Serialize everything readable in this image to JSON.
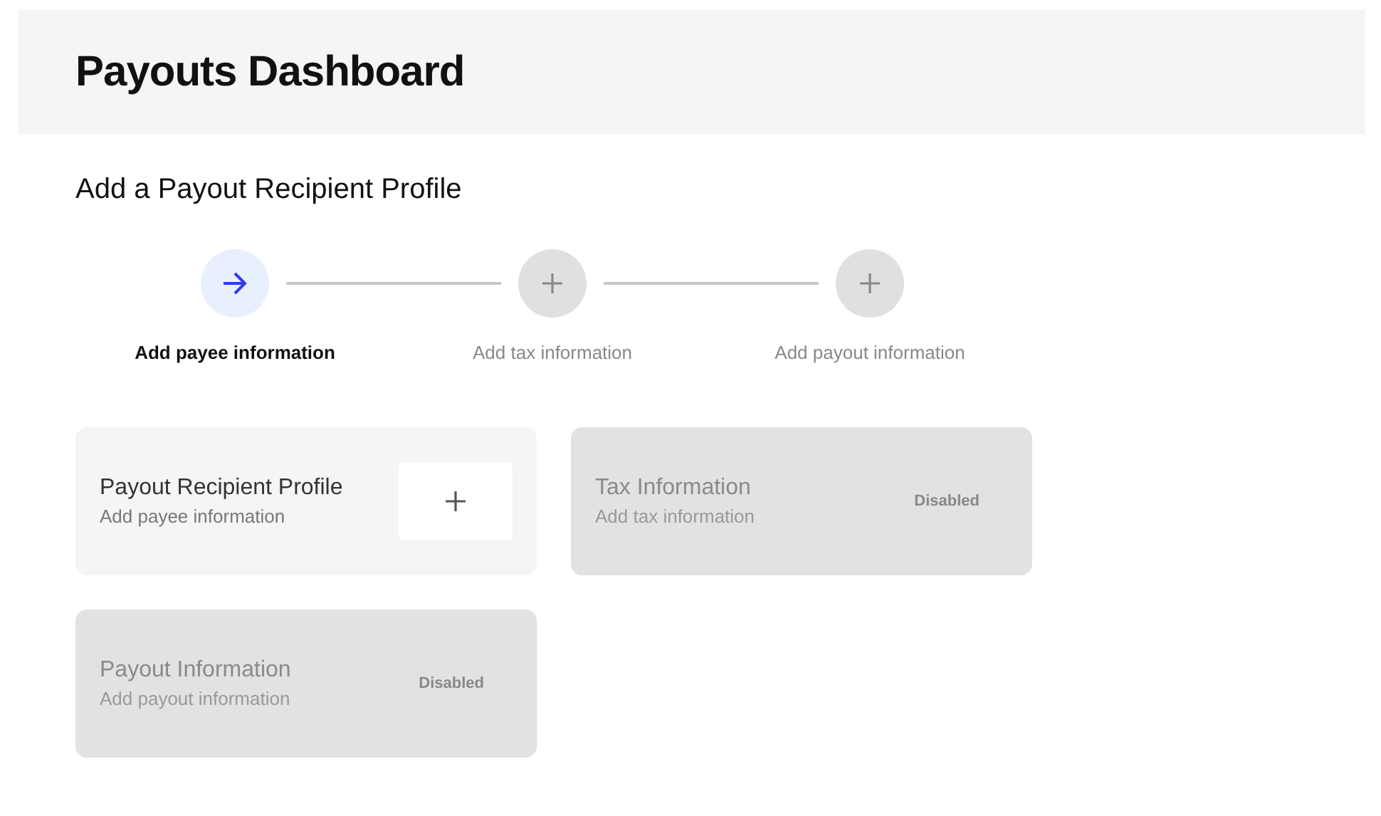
{
  "header": {
    "title": "Payouts Dashboard"
  },
  "section": {
    "title": "Add a Payout Recipient Profile"
  },
  "steps": [
    {
      "label": "Add payee information",
      "selected": true
    },
    {
      "label": "Add tax information",
      "selected": false
    },
    {
      "label": "Add payout information",
      "selected": false
    }
  ],
  "cards": [
    {
      "title": "Payout Recipient Profile",
      "subtitle": "Add payee information",
      "disabled": false
    },
    {
      "title": "Tax Information",
      "subtitle": "Add tax information",
      "disabled": true,
      "status": "Disabled"
    },
    {
      "title": "Payout Information",
      "subtitle": "Add payout information",
      "disabled": true,
      "status": "Disabled"
    }
  ]
}
